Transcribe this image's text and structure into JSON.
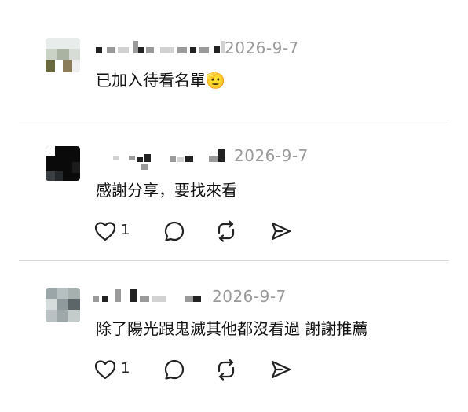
{
  "comments": [
    {
      "timestamp": "2026-9-7",
      "text": "已加入待看名單🫡"
    },
    {
      "timestamp": "2026-9-7",
      "text": "感謝分享，要找來看",
      "like_count": "1"
    },
    {
      "timestamp": "2026-9-7",
      "text": "除了陽光跟鬼滅其他都沒看過 謝謝推薦",
      "like_count": "1"
    }
  ],
  "icons": {
    "like": "heart-icon",
    "reply": "comment-bubble-icon",
    "repost": "repost-icon",
    "share": "send-icon"
  }
}
